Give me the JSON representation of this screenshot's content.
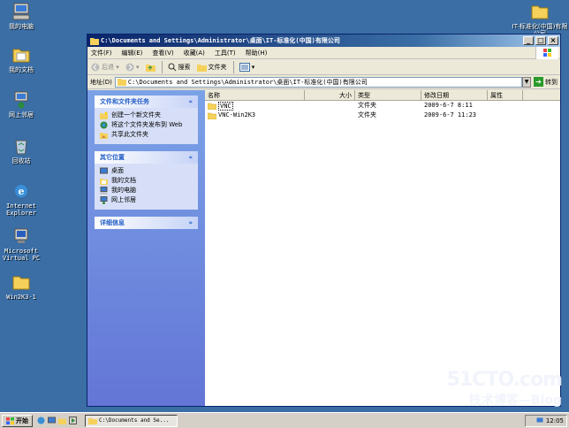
{
  "desktop": {
    "icons": [
      {
        "label": "我的电脑"
      },
      {
        "label": "我的文档"
      },
      {
        "label": "网上邻居"
      },
      {
        "label": "回收站"
      },
      {
        "label": "Internet\nExplorer"
      },
      {
        "label": "Microsoft\nVirtual PC"
      },
      {
        "label": "Win2K3-1"
      },
      {
        "label": "IT-标准化(中国)有限公司"
      }
    ]
  },
  "window": {
    "title": "C:\\Documents and Settings\\Administrator\\桌面\\IT-标准化(中国)有限公司",
    "menu": [
      "文件(F)",
      "编辑(E)",
      "查看(V)",
      "收藏(A)",
      "工具(T)",
      "帮助(H)"
    ],
    "toolbar": {
      "back": "后退",
      "search": "搜索",
      "folders": "文件夹"
    },
    "address": {
      "label": "地址(D)",
      "value": "C:\\Documents and Settings\\Administrator\\桌面\\IT-标准化(中国)有限公司",
      "go": "转到"
    },
    "taskpane": {
      "tasks": {
        "title": "文件和文件夹任务",
        "items": [
          "创建一个新文件夹",
          "将这个文件夹发布到 Web",
          "共享此文件夹"
        ]
      },
      "places": {
        "title": "其它位置",
        "items": [
          "桌面",
          "我的文档",
          "我的电脑",
          "网上邻居"
        ]
      },
      "details": {
        "title": "详细信息"
      }
    },
    "columns": {
      "name": "名称",
      "size": "大小",
      "type": "类型",
      "modified": "修改日期",
      "attr": "属性"
    },
    "files": [
      {
        "name": "VNC",
        "type": "文件夹",
        "modified": "2009-6-7 8:11"
      },
      {
        "name": "VNC-Win2K3",
        "type": "文件夹",
        "modified": "2009-6-7 11:23"
      }
    ]
  },
  "taskbar": {
    "start": "开始",
    "task": "C:\\Documents and Se...",
    "clock": "12:05"
  },
  "watermark": {
    "line1": "51CTO.com",
    "line2": "技术博客—Blog"
  },
  "colors": {
    "desktop": "#3a6ea5",
    "titlebar": "#0a246a",
    "folder": "#f5d15b"
  }
}
